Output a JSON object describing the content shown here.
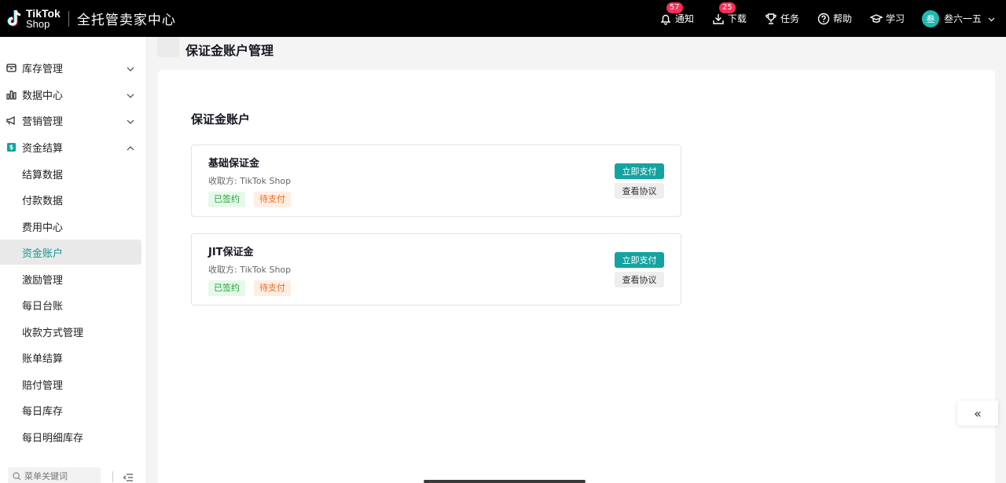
{
  "header": {
    "logo_line1": "TikTok",
    "logo_line2": "Shop",
    "app_title": "全托管卖家中心",
    "actions": [
      {
        "label": "通知",
        "badge": "57",
        "icon": "bell-icon"
      },
      {
        "label": "下载",
        "badge": "25",
        "icon": "download-icon"
      },
      {
        "label": "任务",
        "icon": "trophy-icon"
      },
      {
        "label": "帮助",
        "icon": "help-icon"
      },
      {
        "label": "学习",
        "icon": "graduation-cap-icon"
      }
    ],
    "user": {
      "avatar_text": "叁",
      "name": "叁六一五"
    }
  },
  "sidebar": {
    "groups": [
      {
        "label": "库存管理",
        "icon": "inventory-icon",
        "expanded": false
      },
      {
        "label": "数据中心",
        "icon": "bar-chart-icon",
        "expanded": false
      },
      {
        "label": "营销管理",
        "icon": "megaphone-icon",
        "expanded": false
      },
      {
        "label": "资金结算",
        "icon": "finance-icon",
        "expanded": true
      }
    ],
    "items": [
      {
        "label": "结算数据"
      },
      {
        "label": "付款数据"
      },
      {
        "label": "费用中心"
      },
      {
        "label": "资金账户",
        "active": true
      },
      {
        "label": "激励管理"
      },
      {
        "label": "每日台账"
      },
      {
        "label": "收款方式管理"
      },
      {
        "label": "账单结算"
      },
      {
        "label": "赔付管理"
      },
      {
        "label": "每日库存"
      },
      {
        "label": "每日明细库存"
      }
    ],
    "search_placeholder": "菜单关键词"
  },
  "page": {
    "title": "保证金账户管理",
    "section_title": "保证金账户",
    "deposits": [
      {
        "name": "基础保证金",
        "payee": "收取方: TikTok Shop",
        "tag_signed": "已签约",
        "tag_pending": "待支付",
        "pay_label": "立即支付",
        "agreement_label": "查看协议"
      },
      {
        "name": "JIT保证金",
        "payee": "收取方: TikTok Shop",
        "tag_signed": "已签约",
        "tag_pending": "待支付",
        "pay_label": "立即支付",
        "agreement_label": "查看协议"
      }
    ]
  },
  "floating": {
    "collapse_glyph": "«"
  },
  "colors": {
    "accent": "#14a3a0",
    "badge": "#fe2c55",
    "signed": "#22a43a",
    "pending": "#ef6b1f"
  }
}
